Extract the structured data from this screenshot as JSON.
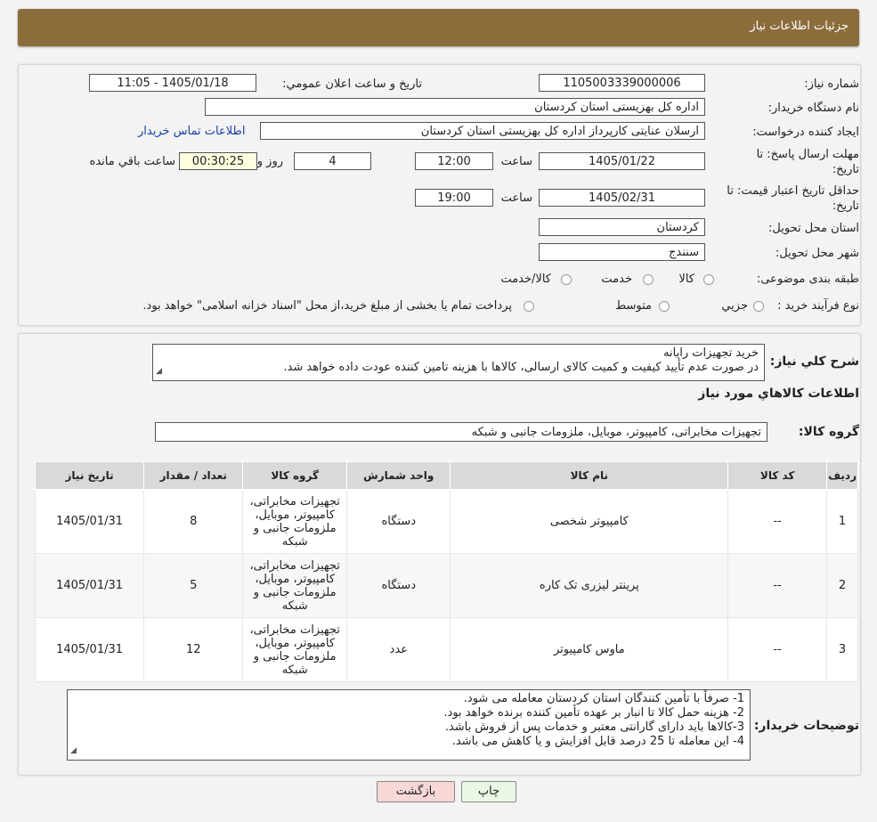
{
  "header": {
    "title": "جزئیات اطلاعات نیاز"
  },
  "form": {
    "need_number_label": "شماره نیاز:",
    "need_number": "1105003339000006",
    "announce_label": "تاریخ و ساعت اعلان عمومي:",
    "announce_value": "1405/01/18 - 11:05",
    "buyer_org_label": "نام دستگاه خریدار:",
    "buyer_org": "اداره کل بهزیستی استان کردستان",
    "creator_label": "ایجاد کننده درخواست:",
    "creator": "ارسلان  عنایتی کارپرداز اداره کل بهزیستی استان کردستان",
    "contact_link": "اطلاعات تماس خریدار",
    "deadline_label_1": "مهلت ارسال پاسخ: تا",
    "deadline_label_2": "تاریخ:",
    "deadline_date": "1405/01/22",
    "time_label": "ساعت",
    "deadline_time": "12:00",
    "days_value": "4",
    "days_label": "روز و",
    "remaining_value": "00:30:25",
    "remaining_label": "ساعت باقي مانده",
    "validity_label_1": "حداقل تاریخ اعتبار قیمت: تا",
    "validity_label_2": "تاریخ:",
    "validity_date": "1405/02/31",
    "validity_time_label": "ساعت",
    "validity_time": "19:00",
    "province_label": "استان محل تحویل:",
    "province": "کردستان",
    "city_label": "شهر محل تحویل:",
    "city": "سنندج",
    "category_label": "طبقه بندی موضوعی:",
    "category_options": [
      "کالا",
      "خدمت",
      "کالا/خدمت"
    ],
    "process_label": "نوع فرآیند خرید :",
    "process_options": [
      "جزیي",
      "متوسط"
    ],
    "process_note": "پرداخت تمام یا بخشی از مبلغ خرید،از محل \"اسناد خزانه اسلامی\" خواهد بود."
  },
  "description": {
    "label": "شرح کلي نیاز:",
    "line1": "خرید تجهیزات رایانه",
    "line2": "در صورت عدم تأیید کیفیت و کمیت کالای ارسالی، کالاها با هزینه تامین کننده عودت داده خواهد شد."
  },
  "goods_title": "اطلاعات کالاهاي مورد نیاز",
  "goods_group_label": "گروه کالا:",
  "goods_group": "تجهیزات مخابراتی، کامپیوتر، موبایل، ملزومات جانبی و شبکه",
  "table": {
    "headers": [
      "ردیف",
      "کد کالا",
      "نام کالا",
      "واحد شمارش",
      "گروه کالا",
      "تعداد / مقدار",
      "تاریخ نیاز"
    ],
    "rows": [
      [
        "1",
        "--",
        "کامپیوتر شخصی",
        "دستگاه",
        "تجهیزات مخابراتی، کامپیوتر، موبایل، ملزومات جانبی و شبکه",
        "8",
        "1405/01/31"
      ],
      [
        "2",
        "--",
        "پرینتر لیزری تک کاره",
        "دستگاه",
        "تجهیزات مخابراتی، کامپیوتر، موبایل، ملزومات جانبی و شبکه",
        "5",
        "1405/01/31"
      ],
      [
        "3",
        "--",
        "ماوس کامپیوتر",
        "عدد",
        "تجهیزات مخابراتی، کامپیوتر، موبایل، ملزومات جانبی و شبکه",
        "12",
        "1405/01/31"
      ]
    ]
  },
  "buyer_notes": {
    "label": "توضیحات خریدار:",
    "lines": [
      "1- صرفاً با تأمین کنندگان استان کردستان معامله می شود.",
      "2- هزینه حمل کالا تا انبار بر عهده تأمین کننده برنده خواهد بود.",
      "3-کالاها باید دارای گارانتی معتبر و خدمات پس از فروش باشد.",
      "4- این معامله تا 25 درصد قابل افزایش و یا کاهش می باشد."
    ]
  },
  "buttons": {
    "print": "چاپ",
    "back": "بازگشت"
  },
  "colors": {
    "header_bg": "#8b6d3c",
    "link": "#1a3fa5",
    "back_button_bg": "#f8d7d7",
    "print_button_bg": "#eaf7e4"
  }
}
